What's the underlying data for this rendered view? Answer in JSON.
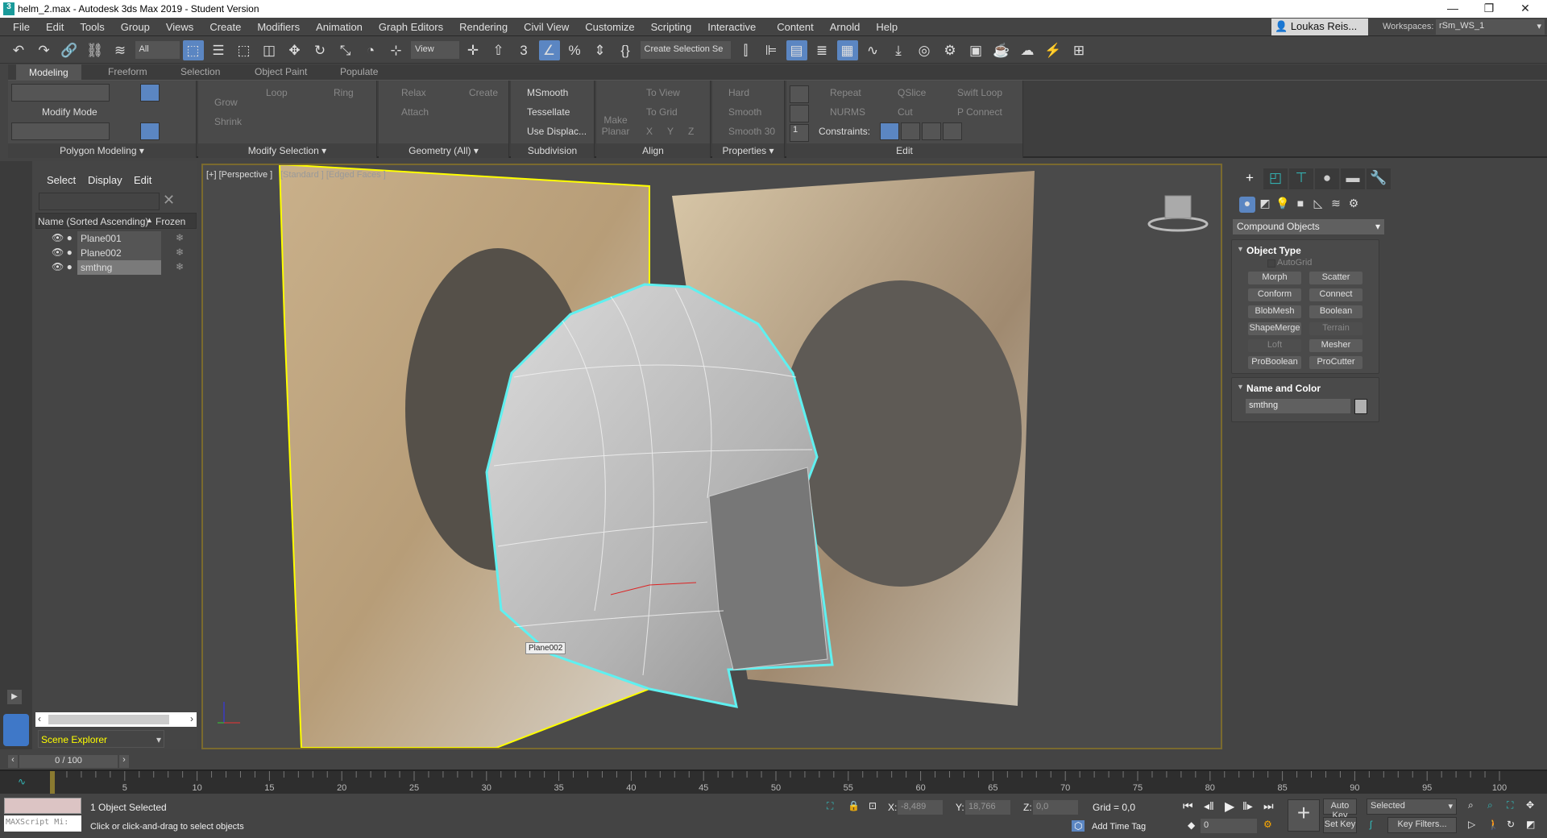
{
  "titlebar": {
    "title": "helm_2.max - Autodesk 3ds Max 2019 - Student Version",
    "logo": "3"
  },
  "menu": [
    "File",
    "Edit",
    "Tools",
    "Group",
    "Views",
    "Create",
    "Modifiers",
    "Animation",
    "Graph Editors",
    "Rendering",
    "Civil View",
    "Customize",
    "Scripting",
    "Interactive",
    "Content",
    "Arnold",
    "Help"
  ],
  "user": {
    "name": "Loukas Reis...",
    "workspaces_label": "Workspaces:",
    "workspace": "rSm_WS_1"
  },
  "toolbar": {
    "filter": "All",
    "ref_coord": "View",
    "selection_set": "Create Selection Se",
    "icons": [
      "undo-icon",
      "redo-icon",
      "link-icon",
      "unlink-icon",
      "bind-space-warp-icon",
      "select-object-icon",
      "select-by-name-icon",
      "rectangle-selection-icon",
      "window-crossing-icon",
      "move-icon",
      "rotate-icon",
      "scale-icon",
      "place-icon",
      "pivot-icon",
      "manipulate-icon",
      "keyboard-shortcut-icon",
      "snaps-toggle-icon",
      "angle-snap-icon",
      "percent-snap-icon",
      "spinner-snap-icon",
      "edit-named-selection-icon",
      "mirror-icon",
      "align-icon",
      "scene-explorer-toggle-icon",
      "layer-explorer-icon",
      "ribbon-toggle-icon",
      "curve-editor-icon",
      "schematic-view-icon",
      "material-editor-icon",
      "render-setup-icon",
      "rendered-frame-window-icon",
      "render-icon",
      "render-cloud-icon",
      "render-production-icon",
      "viewport-layouts-icon"
    ]
  },
  "ribbon": {
    "tabs": [
      "Modeling",
      "Freeform",
      "Selection",
      "Object Paint",
      "Populate"
    ],
    "active_tab": "Modeling",
    "groups": {
      "polygon_modeling": "Polygon Modeling ▾",
      "modify_mode": "Modify Mode",
      "modify_selection": "Modify Selection ▾",
      "geometry": "Geometry (All) ▾",
      "subdivision": "Subdivision",
      "align": "Align",
      "properties": "Properties ▾",
      "edit": "Edit"
    },
    "items": {
      "grow": "Grow",
      "shrink": "Shrink",
      "loop": "Loop",
      "ring": "Ring",
      "relax": "Relax",
      "create": "Create",
      "attach": "Attach",
      "msmooth": "MSmooth",
      "tessellate": "Tessellate",
      "use_displace": "Use Displac...",
      "make_planar": "Make Planar",
      "to_view": "To View",
      "to_grid": "To Grid",
      "x": "X",
      "y": "Y",
      "z": "Z",
      "hard": "Hard",
      "smooth": "Smooth",
      "smooth30": "Smooth 30",
      "repeat": "Repeat",
      "qslice": "QSlice",
      "swift_loop": "Swift Loop",
      "nurms": "NURMS",
      "cut": "Cut",
      "p_connect": "P Connect",
      "constraints": "Constraints:",
      "spinner": "1"
    }
  },
  "explorer": {
    "tabs": [
      "Select",
      "Display",
      "Edit"
    ],
    "col_name": "Name (Sorted Ascending)",
    "col_sort": "▲",
    "col_frozen": "Frozen",
    "rows": [
      {
        "name": "Plane001",
        "selected": false
      },
      {
        "name": "Plane002",
        "selected": false
      },
      {
        "name": "smthng",
        "selected": true
      }
    ],
    "selector": "Scene Explorer"
  },
  "viewport": {
    "label": "[+] [Perspective ]",
    "shading": "[Standard ] [Edged Faces ]",
    "tooltip": "Plane002",
    "axis": {
      "x": "x",
      "y": "y",
      "z": "z"
    },
    "colors": {
      "selection": "#5ff0f0",
      "plane_selected": "#ffff00",
      "border": "#7a6a2e"
    }
  },
  "command_panel": {
    "category": "Compound Objects",
    "object_type": {
      "title": "Object Type",
      "autogrid": "AutoGrid",
      "buttons": [
        {
          "label": "Morph",
          "enabled": true
        },
        {
          "label": "Scatter",
          "enabled": true
        },
        {
          "label": "Conform",
          "enabled": true
        },
        {
          "label": "Connect",
          "enabled": true
        },
        {
          "label": "BlobMesh",
          "enabled": true
        },
        {
          "label": "Boolean",
          "enabled": true
        },
        {
          "label": "ShapeMerge",
          "enabled": true
        },
        {
          "label": "Terrain",
          "enabled": false
        },
        {
          "label": "Loft",
          "enabled": false
        },
        {
          "label": "Mesher",
          "enabled": true
        },
        {
          "label": "ProBoolean",
          "enabled": true
        },
        {
          "label": "ProCutter",
          "enabled": true
        }
      ]
    },
    "name_color": {
      "title": "Name and Color",
      "name": "smthng",
      "color": "#b0b0b0"
    }
  },
  "timeline": {
    "current": "0 / 100",
    "start": 0,
    "end": 100,
    "labels": [
      5,
      10,
      15,
      20,
      25,
      30,
      35,
      40,
      45,
      50,
      55,
      60,
      65,
      70,
      75,
      80,
      85,
      90,
      95,
      100
    ]
  },
  "status": {
    "selected": "1 Object Selected",
    "prompt": "Click or click-and-drag to select objects",
    "maxscript": "MAXScript Mi:",
    "x_label": "X:",
    "x": "-8,489",
    "y_label": "Y:",
    "y": "18,766",
    "z_label": "Z:",
    "z": "0,0",
    "grid": "Grid = 0,0",
    "add_time_tag": "Add Time Tag",
    "auto_key": "Auto Key",
    "set_key": "Set Key",
    "key_mode": "Selected",
    "key_filters": "Key Filters...",
    "frame": "0"
  }
}
